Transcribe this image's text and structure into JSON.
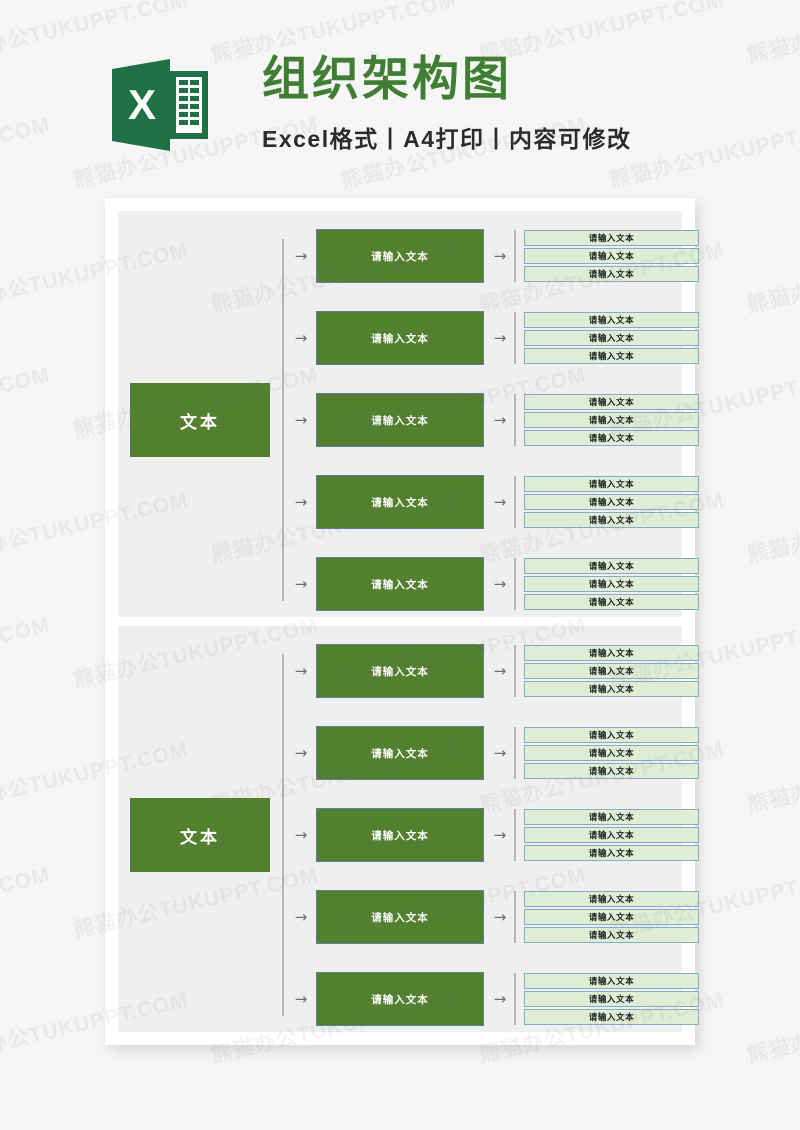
{
  "page": {
    "background_color": "#f5f5f5",
    "sheet_color": "#ffffff",
    "panel_color": "#efefef"
  },
  "header": {
    "logo_icon": "excel-logo-icon",
    "logo_color": "#1f7145",
    "title": "组织架构图",
    "title_color": "#3f7e33",
    "subtitle": "Excel格式丨A4打印丨内容可修改",
    "subtitle_color": "#2b2b2b"
  },
  "watermark": {
    "text": "熊猫办公TUKUPPT.COM",
    "color": "rgba(120,120,120,0.085)"
  },
  "colors": {
    "node_green": "#52802f",
    "node_border": "#5f7e9c",
    "leaf_green": "#dfedd5",
    "leaf_border": "#86abc7",
    "connector_gray": "#b5b5b5",
    "arrow_gray": "#6f6f6f"
  },
  "icons": {
    "arrow_right": "→"
  },
  "chart_data": {
    "type": "diagram",
    "title": "组织架构图",
    "subtitle": "Excel格式丨A4打印丨内容可修改",
    "orientation": "left-to-right",
    "levels": 3,
    "panels": [
      {
        "root": {
          "label": "文本"
        },
        "branches": [
          {
            "label": "请输入文本",
            "leaves": [
              "请输入文本",
              "请输入文本",
              "请输入文本"
            ]
          },
          {
            "label": "请输入文本",
            "leaves": [
              "请输入文本",
              "请输入文本",
              "请输入文本"
            ]
          },
          {
            "label": "请输入文本",
            "leaves": [
              "请输入文本",
              "请输入文本",
              "请输入文本"
            ]
          },
          {
            "label": "请输入文本",
            "leaves": [
              "请输入文本",
              "请输入文本",
              "请输入文本"
            ]
          },
          {
            "label": "请输入文本",
            "leaves": [
              "请输入文本",
              "请输入文本",
              "请输入文本"
            ]
          }
        ]
      },
      {
        "root": {
          "label": "文本"
        },
        "branches": [
          {
            "label": "请输入文本",
            "leaves": [
              "请输入文本",
              "请输入文本",
              "请输入文本"
            ]
          },
          {
            "label": "请输入文本",
            "leaves": [
              "请输入文本",
              "请输入文本",
              "请输入文本"
            ]
          },
          {
            "label": "请输入文本",
            "leaves": [
              "请输入文本",
              "请输入文本",
              "请输入文本"
            ]
          },
          {
            "label": "请输入文本",
            "leaves": [
              "请输入文本",
              "请输入文本",
              "请输入文本"
            ]
          },
          {
            "label": "请输入文本",
            "leaves": [
              "请输入文本",
              "请输入文本",
              "请输入文本"
            ]
          }
        ]
      }
    ]
  }
}
